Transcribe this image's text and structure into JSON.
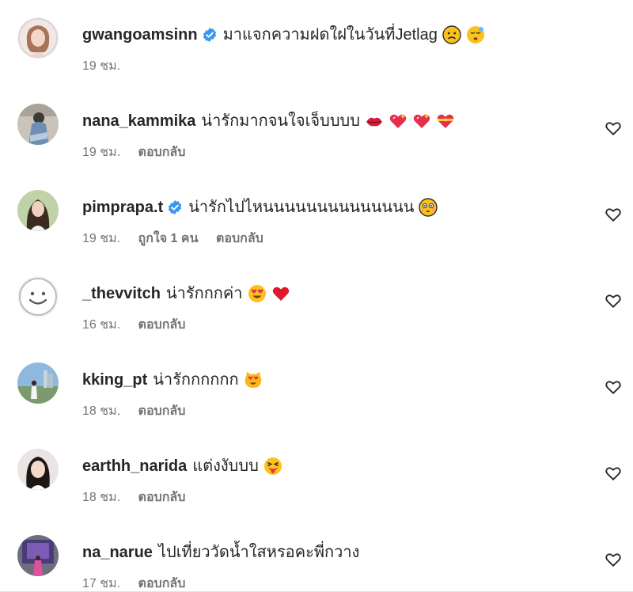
{
  "comments": [
    {
      "username": "gwangoamsinn",
      "verified": true,
      "text": "มาแจกความฝดใฝในวันที่Jetlag",
      "emojis": [
        "sad-face-emoji",
        "sleepy-face-emoji"
      ],
      "time": "19 ชม.",
      "likes": "",
      "reply": "",
      "show_heart": false
    },
    {
      "username": "nana_kammika",
      "verified": false,
      "text": "น่ารักมากจนใจเจ็บบบบ",
      "emojis": [
        "lips-emoji",
        "sparkling-heart-emoji",
        "sparkling-heart-emoji",
        "heart-with-ribbon-emoji"
      ],
      "time": "19 ชม.",
      "likes": "",
      "reply": "ตอบกลับ",
      "show_heart": true
    },
    {
      "username": "pimprapa.t",
      "verified": true,
      "text": "น่ารักไปไหนนนนนนนนนนนนนน",
      "emojis": [
        "flushed-face-emoji"
      ],
      "time": "19 ชม.",
      "likes": "ถูกใจ 1 คน",
      "reply": "ตอบกลับ",
      "show_heart": true
    },
    {
      "username": "_thevvitch",
      "verified": false,
      "text": "น่ารักกกค่า",
      "emojis": [
        "heart-eyes-emoji",
        "red-heart-emoji"
      ],
      "time": "16 ชม.",
      "likes": "",
      "reply": "ตอบกลับ",
      "show_heart": true
    },
    {
      "username": "kking_pt",
      "verified": false,
      "text": "น่ารักกกกกก",
      "emojis": [
        "heart-eyes-cat-emoji"
      ],
      "time": "18 ชม.",
      "likes": "",
      "reply": "ตอบกลับ",
      "show_heart": true
    },
    {
      "username": "earthh_narida",
      "verified": false,
      "text": "แต่งงับบบ",
      "emojis": [
        "squinting-tongue-emoji"
      ],
      "time": "18 ชม.",
      "likes": "",
      "reply": "ตอบกลับ",
      "show_heart": true
    },
    {
      "username": "na_narue",
      "verified": false,
      "text": "ไปเที่ยววัดน้ำใสหรอคะพี่กวาง",
      "emojis": [],
      "time": "17 ชม.",
      "likes": "",
      "reply": "ตอบกลับ",
      "show_heart": true
    }
  ],
  "colors": {
    "verified_blue": "#3897f0",
    "meta_gray": "#737373",
    "text_dark": "#262626"
  }
}
